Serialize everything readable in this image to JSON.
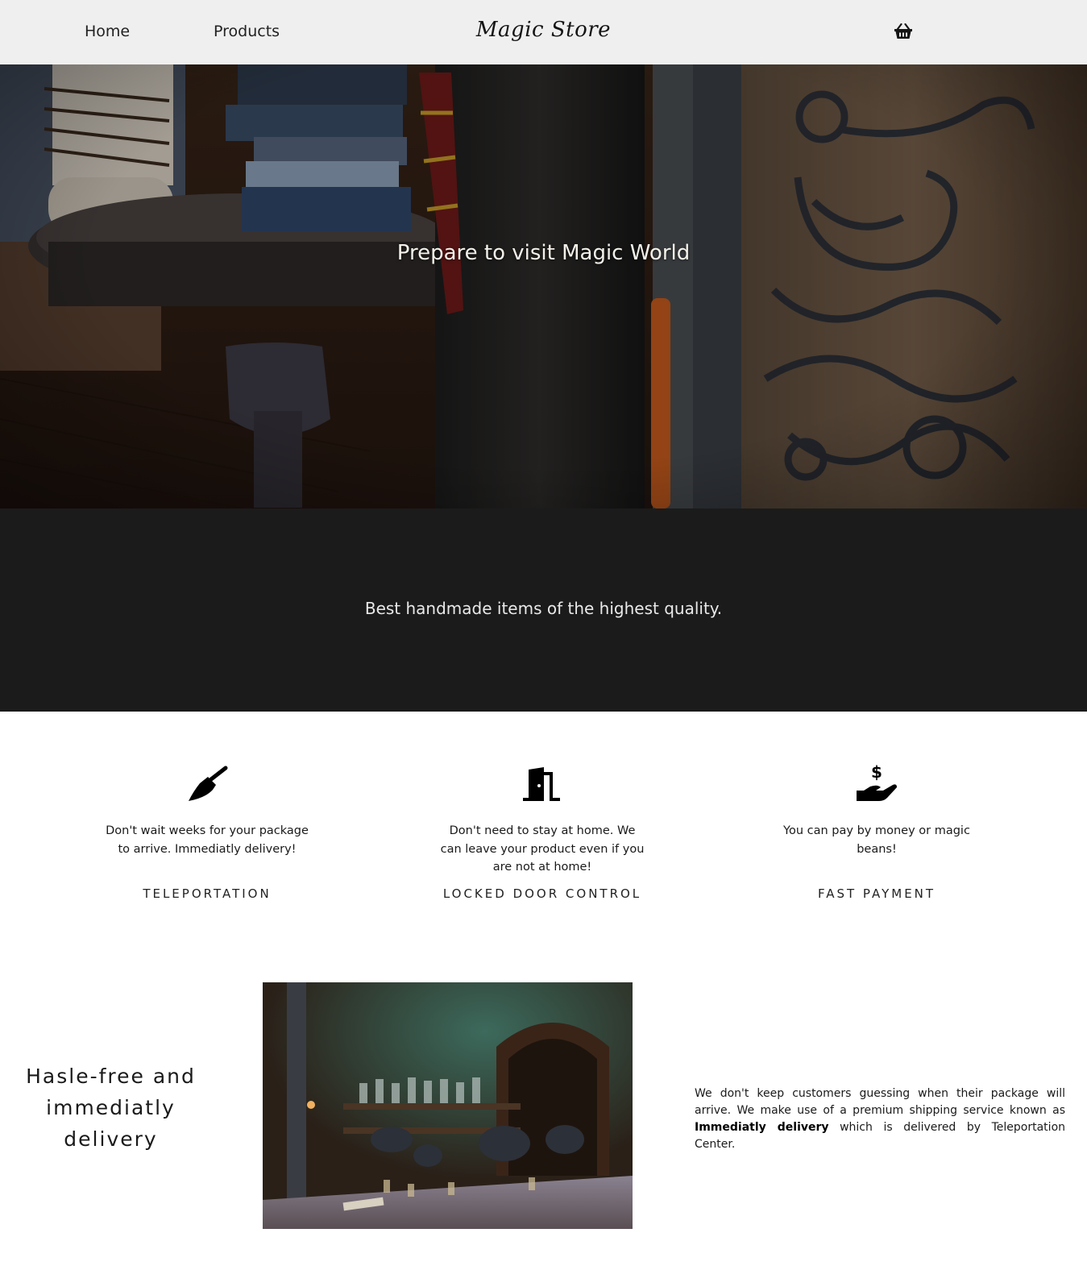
{
  "header": {
    "nav": [
      {
        "label": "Home"
      },
      {
        "label": "Products"
      }
    ],
    "logo": "Magic Store",
    "cart_icon": "basket-icon"
  },
  "hero": {
    "title": "Prepare to visit Magic World"
  },
  "band": {
    "text": "Best handmade items of the highest quality."
  },
  "features": [
    {
      "icon": "broom-icon",
      "description": "Don't wait weeks for your package to arrive. Immediatly delivery!",
      "title": "TELEPORTATION"
    },
    {
      "icon": "door-open-icon",
      "description": "Don't need to stay at home. We can leave your product even if you are not at home!",
      "title": "LOCKED DOOR CONTROL"
    },
    {
      "icon": "hand-dollar-icon",
      "description": "You can pay by money or magic beans!",
      "title": "FAST PAYMENT"
    }
  ],
  "delivery": {
    "title": "Hasle-free and immediatly delivery",
    "text_before": "We don't keep customers guessing when their package will arrive. We make use of a premium shipping service known as ",
    "text_bold": "Immediatly delivery",
    "text_after": " which is delivered by Teleportation Center."
  },
  "colors": {
    "header_bg": "#efefef",
    "band_bg": "#1b1b1b",
    "hero_text": "#f4f1ea"
  }
}
